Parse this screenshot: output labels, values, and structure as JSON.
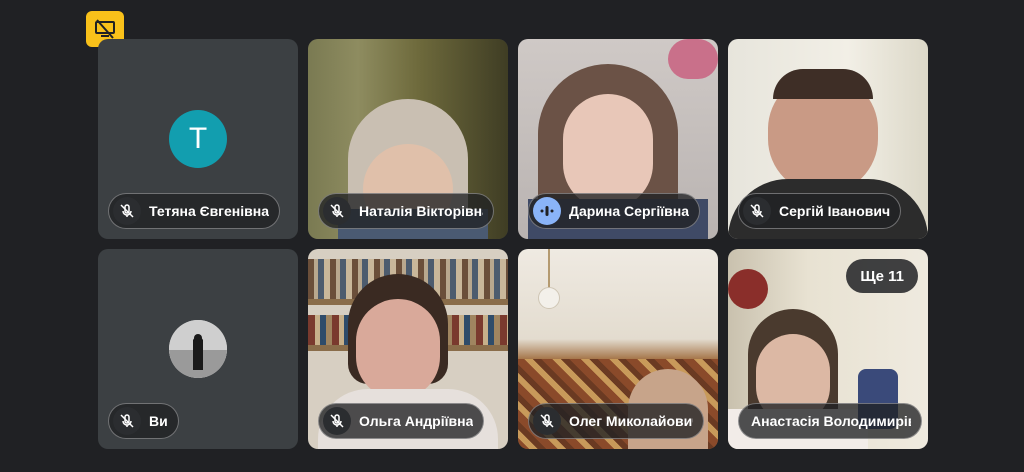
{
  "top_badge_icon": "screen-share-off-icon",
  "tiles": [
    {
      "name": "Тетяна Євгенівна",
      "mic": "muted",
      "avatar_letter": "T"
    },
    {
      "name": "Наталія Вікторівна",
      "mic": "muted"
    },
    {
      "name": "Дарина Сергіївна",
      "mic": "speaking"
    },
    {
      "name": "Сергій Іванович",
      "mic": "muted"
    },
    {
      "name": "Ви",
      "mic": "muted"
    },
    {
      "name": "Ольга Андріївна",
      "mic": "muted"
    },
    {
      "name": "Олег Миколайович",
      "mic": "muted"
    },
    {
      "name": "Анастасія Володимирівна",
      "mic": "none"
    }
  ],
  "more_participants_label": "Ще 11",
  "colors": {
    "badge": "#f9c11a",
    "avatar": "#129eaf",
    "tile": "#3c4043",
    "background": "#202124"
  }
}
